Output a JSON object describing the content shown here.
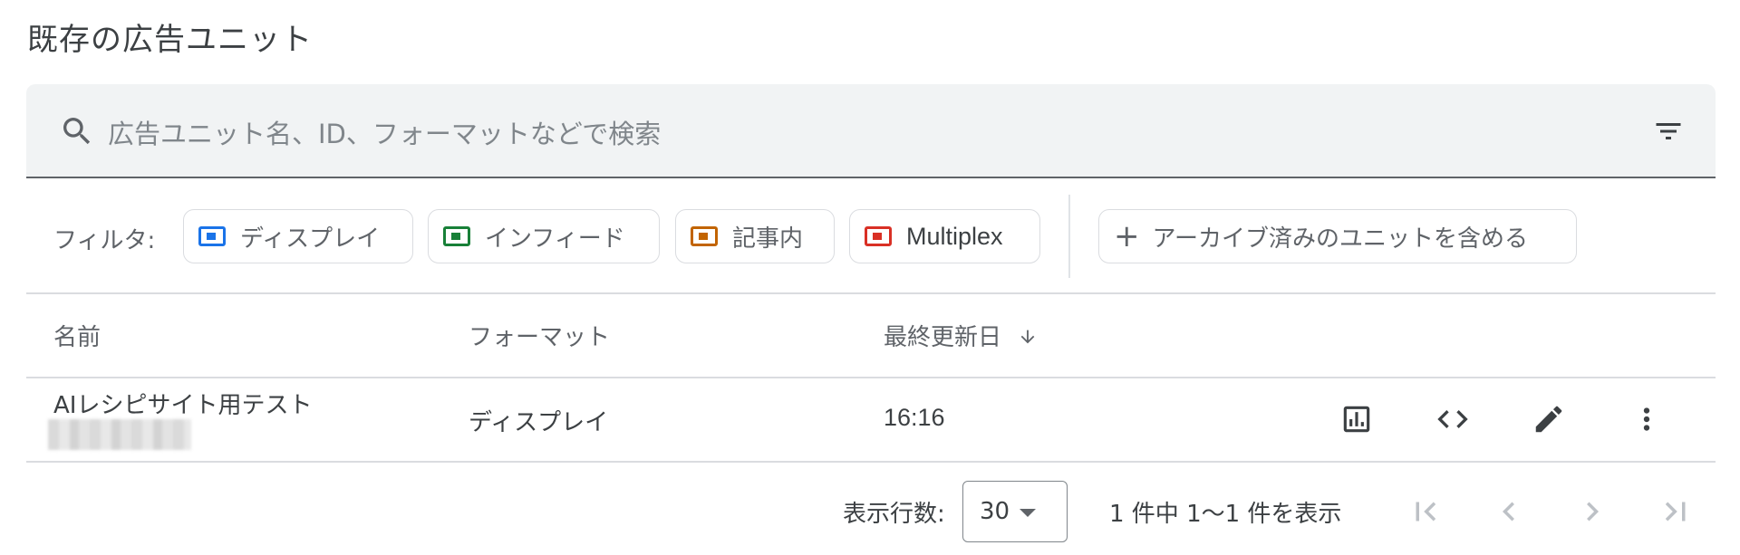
{
  "page": {
    "title": "既存の広告ユニット"
  },
  "search": {
    "placeholder": "広告ユニット名、ID、フォーマットなどで検索"
  },
  "filters": {
    "label": "フィルタ:",
    "chips": [
      {
        "label": "ディスプレイ",
        "color": "#1a73e8"
      },
      {
        "label": "インフィード",
        "color": "#188038"
      },
      {
        "label": "記事内",
        "color": "#c26401"
      },
      {
        "label": "Multiplex",
        "color": "#d93025"
      }
    ],
    "archive_label": "アーカイブ済みのユニットを含める"
  },
  "table": {
    "headers": {
      "name": "名前",
      "format": "フォーマット",
      "updated": "最終更新日"
    },
    "sort": {
      "column": "updated",
      "direction": "descending"
    },
    "rows": [
      {
        "name": "AIレシピサイト用テスト",
        "format": "ディスプレイ",
        "updated": "16:16"
      }
    ],
    "row_actions": [
      "report-icon",
      "code-icon",
      "edit-icon",
      "more-vert-icon"
    ]
  },
  "pagination": {
    "rows_label": "表示行数:",
    "rows_per_page": "30",
    "range_text": "1 件中 1〜1 件を表示"
  }
}
